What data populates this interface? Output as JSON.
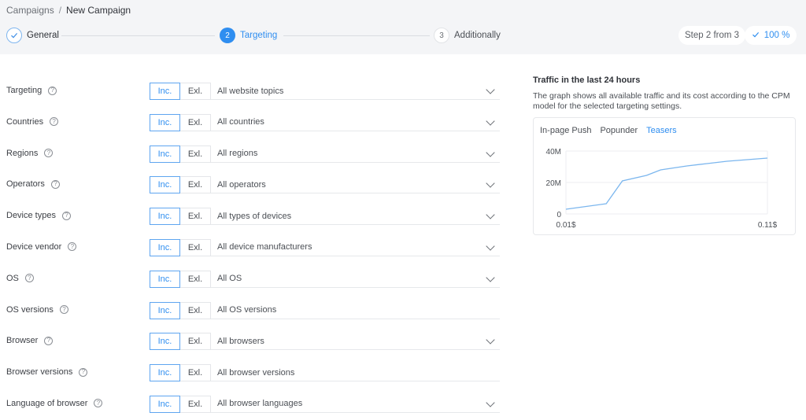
{
  "breadcrumb": {
    "root": "Campaigns",
    "separator": "/",
    "current": "New Campaign"
  },
  "steps": [
    {
      "number": "",
      "label": "General",
      "state": "done"
    },
    {
      "number": "2",
      "label": "Targeting",
      "state": "active"
    },
    {
      "number": "3",
      "label": "Additionally",
      "state": "pending"
    }
  ],
  "step_count": "Step 2 from 3",
  "progress": {
    "label": "100 %",
    "value": 100
  },
  "rows": [
    {
      "label": "Targeting",
      "value": "All website topics",
      "chevron": true
    },
    {
      "label": "Countries",
      "value": "All countries",
      "chevron": true
    },
    {
      "label": "Regions",
      "value": "All regions",
      "chevron": true
    },
    {
      "label": "Operators",
      "value": "All operators",
      "chevron": true
    },
    {
      "label": "Device types",
      "value": "All types of devices",
      "chevron": true
    },
    {
      "label": "Device vendor",
      "value": "All device manufacturers",
      "chevron": true
    },
    {
      "label": "OS",
      "value": "All OS",
      "chevron": true
    },
    {
      "label": "OS versions",
      "value": "All OS versions",
      "chevron": false
    },
    {
      "label": "Browser",
      "value": "All browsers",
      "chevron": true
    },
    {
      "label": "Browser versions",
      "value": "All browser versions",
      "chevron": false
    },
    {
      "label": "Language of browser",
      "value": "All browser languages",
      "chevron": true
    }
  ],
  "toggle": {
    "inc": "Inc.",
    "exl": "Exl."
  },
  "help_glyph": "?",
  "traffic": {
    "title": "Traffic in the last 24 hours",
    "description": "The graph shows all available traffic and its cost according to the CPM model for the selected targeting settings.",
    "tabs": [
      "In-page Push",
      "Popunder",
      "Teasers"
    ],
    "active_tab": 2
  },
  "chart_data": {
    "type": "line",
    "x": [
      0.01,
      0.03,
      0.038,
      0.05,
      0.057,
      0.07,
      0.08,
      0.09,
      0.11
    ],
    "series": [
      {
        "values": [
          3,
          6.5,
          21,
          24.5,
          28,
          30.5,
          32,
          33.5,
          35.5
        ]
      }
    ],
    "x_tick_labels": [
      "0.01$",
      "0.11$"
    ],
    "y_tick_labels": [
      "0",
      "20M",
      "40M"
    ],
    "ylim": [
      0,
      40
    ],
    "xlim": [
      0.01,
      0.11
    ],
    "grid": true,
    "line_color": "#7bb6ee"
  },
  "colors": {
    "accent": "#2f8ef0",
    "header_bg": "#f4f5f7"
  }
}
